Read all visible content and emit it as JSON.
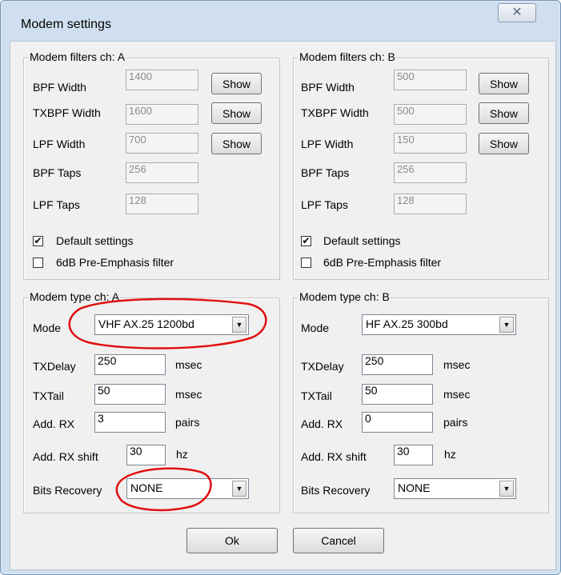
{
  "window": {
    "title": "Modem settings",
    "close_glyph": "✕"
  },
  "filters_a": {
    "legend": "Modem filters ch: A",
    "rows": [
      {
        "label": "BPF Width",
        "value": "1400",
        "button": "Show"
      },
      {
        "label": "TXBPF Width",
        "value": "1600",
        "button": "Show"
      },
      {
        "label": "LPF Width",
        "value": "700",
        "button": "Show"
      },
      {
        "label": "BPF Taps",
        "value": "256"
      },
      {
        "label": "LPF Taps",
        "value": "128"
      }
    ],
    "default_settings": {
      "label": "Default settings",
      "checked": true
    },
    "pre_emphasis": {
      "label": "6dB Pre-Emphasis filter",
      "checked": false
    }
  },
  "filters_b": {
    "legend": "Modem filters ch: B",
    "rows": [
      {
        "label": "BPF Width",
        "value": "500",
        "button": "Show"
      },
      {
        "label": "TXBPF Width",
        "value": "500",
        "button": "Show"
      },
      {
        "label": "LPF Width",
        "value": "150",
        "button": "Show"
      },
      {
        "label": "BPF Taps",
        "value": "256"
      },
      {
        "label": "LPF Taps",
        "value": "128"
      }
    ],
    "default_settings": {
      "label": "Default settings",
      "checked": true
    },
    "pre_emphasis": {
      "label": "6dB Pre-Emphasis filter",
      "checked": false
    }
  },
  "modem_a": {
    "legend": "Modem type ch: A",
    "mode_label": "Mode",
    "mode_value": "VHF AX.25 1200bd",
    "txdelay_label": "TXDelay",
    "txdelay_value": "250",
    "txdelay_unit": "msec",
    "txtail_label": "TXTail",
    "txtail_value": "50",
    "txtail_unit": "msec",
    "addrx_label": "Add. RX",
    "addrx_value": "3",
    "addrx_unit": "pairs",
    "addrxshift_label": "Add. RX shift",
    "addrxshift_value": "30",
    "addrxshift_unit": "hz",
    "bits_label": "Bits Recovery",
    "bits_value": "NONE"
  },
  "modem_b": {
    "legend": "Modem type ch: B",
    "mode_label": "Mode",
    "mode_value": "HF AX.25 300bd",
    "txdelay_label": "TXDelay",
    "txdelay_value": "250",
    "txdelay_unit": "msec",
    "txtail_label": "TXTail",
    "txtail_value": "50",
    "txtail_unit": "msec",
    "addrx_label": "Add. RX",
    "addrx_value": "0",
    "addrx_unit": "pairs",
    "addrxshift_label": "Add. RX shift",
    "addrxshift_value": "30",
    "addrxshift_unit": "hz",
    "bits_label": "Bits Recovery",
    "bits_value": "NONE"
  },
  "buttons": {
    "ok": "Ok",
    "cancel": "Cancel"
  },
  "colors": {
    "annotation": "#e01010",
    "title_bar": "#cfdfef"
  }
}
